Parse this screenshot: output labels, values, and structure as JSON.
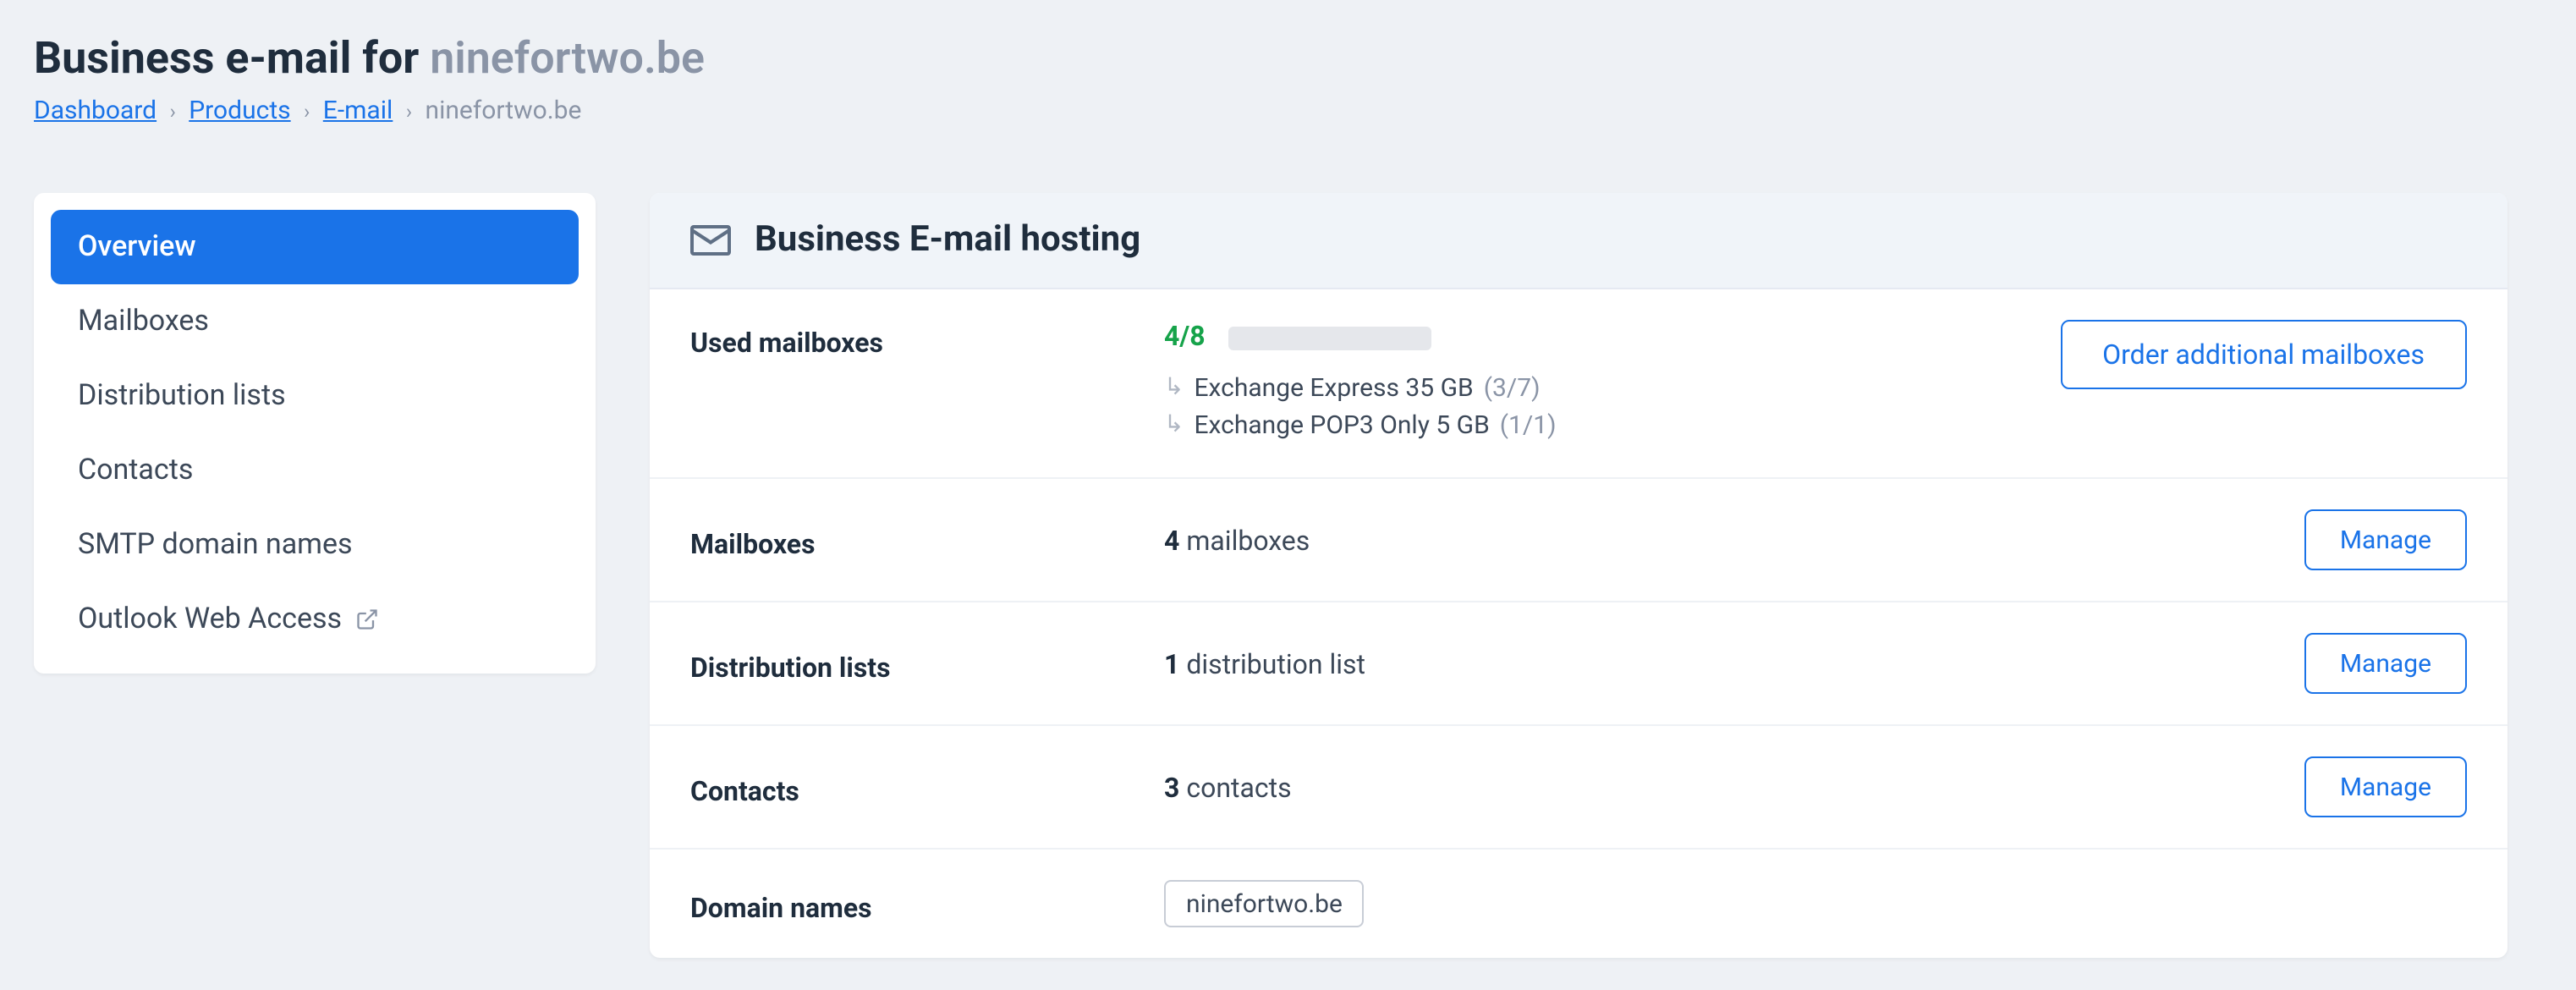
{
  "header": {
    "title_prefix": "Business e-mail for ",
    "domain": "ninefortwo.be"
  },
  "breadcrumb": {
    "items": [
      {
        "label": "Dashboard",
        "link": true
      },
      {
        "label": "Products",
        "link": true
      },
      {
        "label": "E-mail",
        "link": true
      },
      {
        "label": "ninefortwo.be",
        "link": false
      }
    ]
  },
  "sidebar": {
    "items": [
      {
        "label": "Overview",
        "active": true
      },
      {
        "label": "Mailboxes"
      },
      {
        "label": "Distribution lists"
      },
      {
        "label": "Contacts"
      },
      {
        "label": "SMTP domain names"
      },
      {
        "label": "Outlook Web Access",
        "external": true
      }
    ]
  },
  "panel": {
    "title": "Business E-mail hosting",
    "used_mailboxes": {
      "label": "Used mailboxes",
      "count_text": "4/8",
      "progress_percent": 50,
      "order_button": "Order additional mailboxes",
      "breakdown": [
        {
          "name": "Exchange Express 35 GB",
          "count": "(3/7)"
        },
        {
          "name": "Exchange POP3 Only 5 GB",
          "count": "(1/1)"
        }
      ]
    },
    "rows": [
      {
        "label": "Mailboxes",
        "count": "4",
        "unit": " mailboxes",
        "action": "Manage"
      },
      {
        "label": "Distribution lists",
        "count": "1",
        "unit": " distribution list",
        "action": "Manage"
      },
      {
        "label": "Contacts",
        "count": "3",
        "unit": " contacts",
        "action": "Manage"
      }
    ],
    "domain_names": {
      "label": "Domain names",
      "chip": "ninefortwo.be"
    }
  }
}
